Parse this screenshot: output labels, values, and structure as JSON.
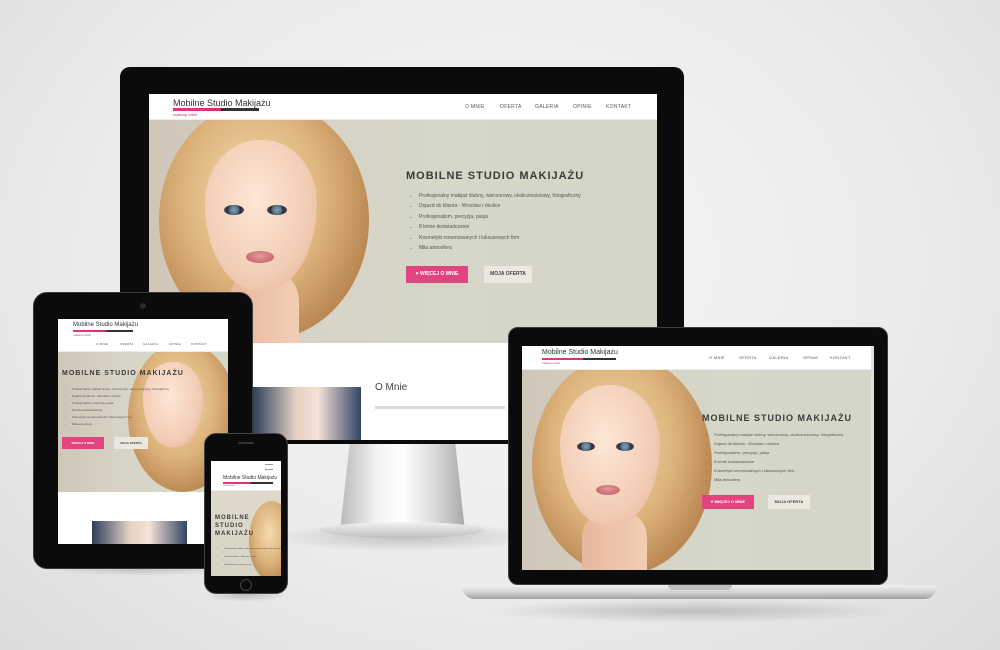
{
  "site": {
    "logo_title": "Mobilne Studio Makijażu",
    "logo_subtitle": "makeup artist",
    "nav": [
      "O MNIE",
      "OFERTA",
      "GALERIA",
      "OPINIE",
      "KONTAKT"
    ],
    "hero_title": "MOBILNE STUDIO MAKIJAŻU",
    "hero_title_mobile_lines": [
      "MOBILNE",
      "STUDIO",
      "MAKIJAŻU"
    ],
    "features": [
      "Profesjonalny makijaż ślubny, wieczorowy, okolicznościowy, fotograficzny",
      "Dojazd do klienta - Wrocław i okolice",
      "Profesjonalizm, precyzja, pasja",
      "8 letnie doświadczenie",
      "Kosmetyki renomowanych i luksusowych firm",
      "Miła atmosfera"
    ],
    "button_primary": "WIĘCEJ O MNIE",
    "button_secondary": "MOJA OFERTA",
    "about_heading": "O Mnie"
  },
  "colors": {
    "accent_pink": "#e0457f",
    "bezel": "#0b0b0b",
    "background": "#ebebeb"
  },
  "icons": {
    "feature_bullet": "arrow-right-icon",
    "button_icon": "heart-icon"
  },
  "devices": [
    "desktop-monitor",
    "tablet",
    "smartphone",
    "laptop"
  ]
}
